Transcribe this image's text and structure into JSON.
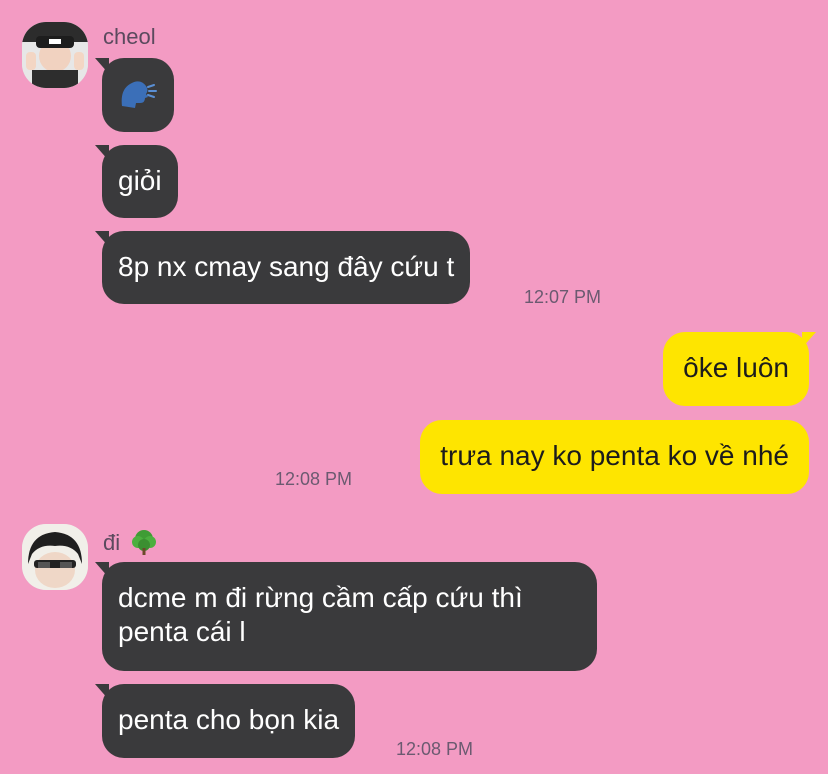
{
  "chat": {
    "senders": {
      "cheol": "cheol",
      "di": "đi"
    },
    "messages": {
      "m1_icon": "speaking-head-emoji",
      "m2": "giỏi",
      "m3": "8p nx cmay sang đây cứu t",
      "m3_time": "12:07 PM",
      "m4": "ôke luôn",
      "m5": "trưa nay ko penta ko về nhé",
      "m5_time": "12:08 PM",
      "m6": "dcme m đi rừng cầm cấp cứu thì penta cái l",
      "m7": "penta cho bọn kia",
      "m7_time": "12:08 PM"
    },
    "name_icon": "green-tree-emoji"
  },
  "colors": {
    "background": "#f39bc3",
    "incoming_bubble": "#3a3a3c",
    "outgoing_bubble": "#fee500"
  }
}
